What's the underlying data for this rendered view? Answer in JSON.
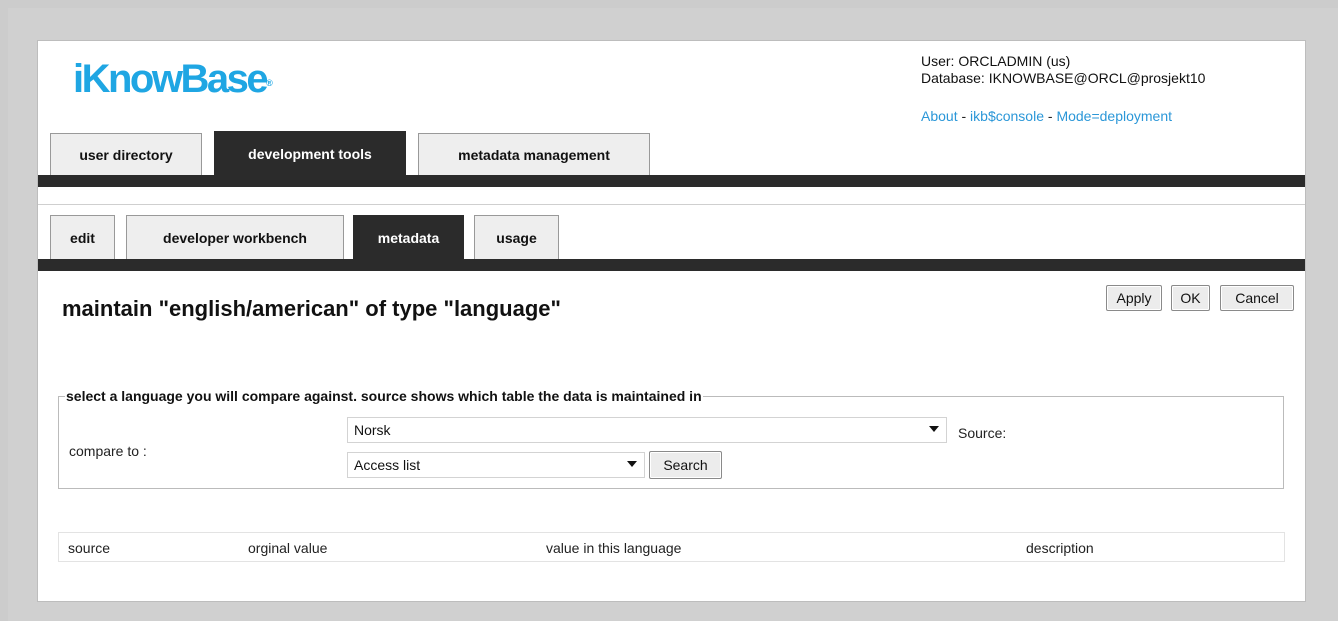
{
  "brand": {
    "logo_text": "iKnowBase",
    "logo_mark": "®"
  },
  "user": {
    "line1": "User: ORCLADMIN (us)",
    "line2": "Database: IKNOWBASE@ORCL@prosjekt10"
  },
  "links": {
    "about": "About",
    "sep": " - ",
    "console": "ikb$console",
    "mode": "Mode=deployment"
  },
  "main_tabs": [
    {
      "label": "user directory"
    },
    {
      "label": "development tools"
    },
    {
      "label": "metadata management"
    }
  ],
  "sub_tabs": [
    {
      "label": "edit"
    },
    {
      "label": "developer workbench"
    },
    {
      "label": "metadata"
    },
    {
      "label": "usage"
    }
  ],
  "page": {
    "title": "maintain \"english/american\" of type \"language\""
  },
  "actions": {
    "apply": "Apply",
    "ok": "OK",
    "cancel": "Cancel"
  },
  "compare": {
    "legend": "select a language you will compare against. source shows which table the data is maintained in",
    "label": "compare to :",
    "language_value": "Norsk",
    "source_label": "Source:",
    "access_value": "Access list",
    "search": "Search"
  },
  "table": {
    "columns": [
      "source",
      "orginal value",
      "value in this language",
      "description"
    ]
  },
  "colors": {
    "accent": "#1fa6e3",
    "link": "#2b97d8",
    "dark_bar": "#2b2b2b"
  }
}
